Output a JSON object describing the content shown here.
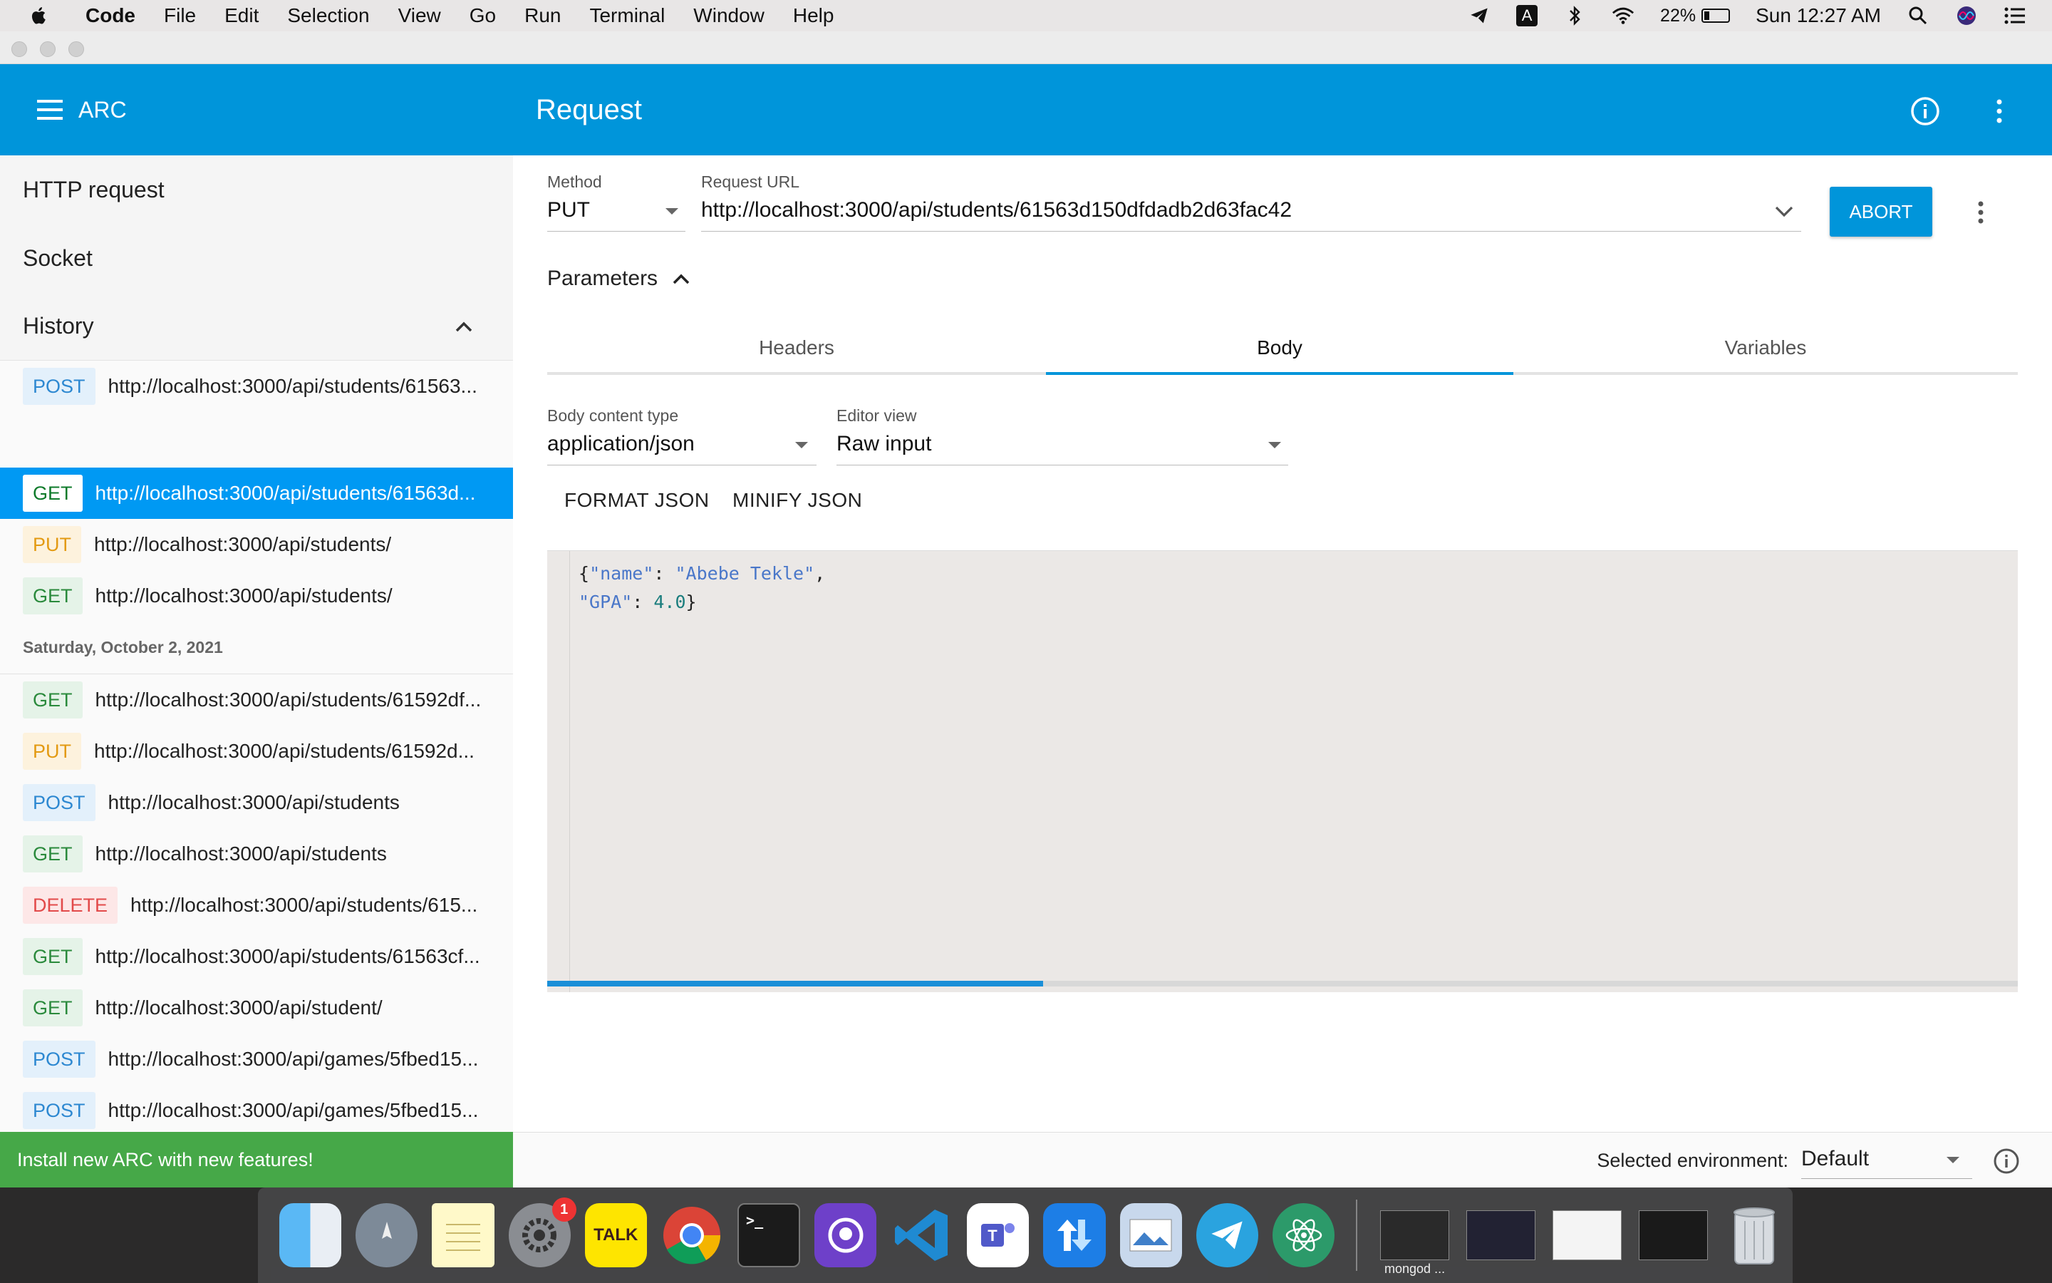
{
  "menubar": {
    "app_name": "Code",
    "items": [
      "File",
      "Edit",
      "Selection",
      "View",
      "Go",
      "Run",
      "Terminal",
      "Window",
      "Help"
    ],
    "battery_percent": "22%",
    "battery_level": 0.22,
    "clock": "Sun 12:27 AM",
    "input_source": "A"
  },
  "sidebar": {
    "app_title": "ARC",
    "nav": {
      "http_request": "HTTP request",
      "socket": "Socket",
      "history": "History"
    },
    "history_top": [
      {
        "method": "POST",
        "url": "http://localhost:3000/api/students/61563..."
      }
    ],
    "history_today": [
      {
        "method": "GET",
        "url": "http://localhost:3000/api/students/61563d...",
        "selected": true
      },
      {
        "method": "PUT",
        "url": "http://localhost:3000/api/students/"
      },
      {
        "method": "GET",
        "url": "http://localhost:3000/api/students/"
      }
    ],
    "date_group": "Saturday, October 2, 2021",
    "history_older": [
      {
        "method": "GET",
        "url": "http://localhost:3000/api/students/61592df..."
      },
      {
        "method": "PUT",
        "url": "http://localhost:3000/api/students/61592d..."
      },
      {
        "method": "POST",
        "url": "http://localhost:3000/api/students"
      },
      {
        "method": "GET",
        "url": "http://localhost:3000/api/students"
      },
      {
        "method": "DELETE",
        "url": "http://localhost:3000/api/students/615..."
      },
      {
        "method": "GET",
        "url": "http://localhost:3000/api/students/61563cf..."
      },
      {
        "method": "GET",
        "url": "http://localhost:3000/api/student/"
      },
      {
        "method": "POST",
        "url": "http://localhost:3000/api/games/5fbed15..."
      },
      {
        "method": "POST",
        "url": "http://localhost:3000/api/games/5fbed15..."
      }
    ],
    "install_banner": "Install new ARC with new features!"
  },
  "main": {
    "title": "Request",
    "method_label": "Method",
    "method_value": "PUT",
    "url_label": "Request URL",
    "url_value": "http://localhost:3000/api/students/61563d150dfdadb2d63fac42",
    "abort_label": "ABORT",
    "parameters_label": "Parameters",
    "tabs": [
      "Headers",
      "Body",
      "Variables"
    ],
    "active_tab": "Body",
    "body_content_type_label": "Body content type",
    "body_content_type_value": "application/json",
    "editor_view_label": "Editor view",
    "editor_view_value": "Raw input",
    "format_json": "FORMAT JSON",
    "minify_json": "MINIFY JSON",
    "code_lines": [
      "{\"name\": \"Abebe Tekle\",",
      "\"GPA\": 4.0}"
    ],
    "progress": 0.337
  },
  "footer": {
    "selected_env_label": "Selected environment:",
    "selected_env_value": "Default"
  },
  "dock": {
    "system_prefs_badge": "1",
    "kakao_label": "TALK",
    "terminal_prompt": ">_",
    "window_thumb_caption": "mongod ..."
  },
  "colors": {
    "accent": "#0095da",
    "banner_green": "#46a848",
    "selected_row": "#0099f3"
  }
}
